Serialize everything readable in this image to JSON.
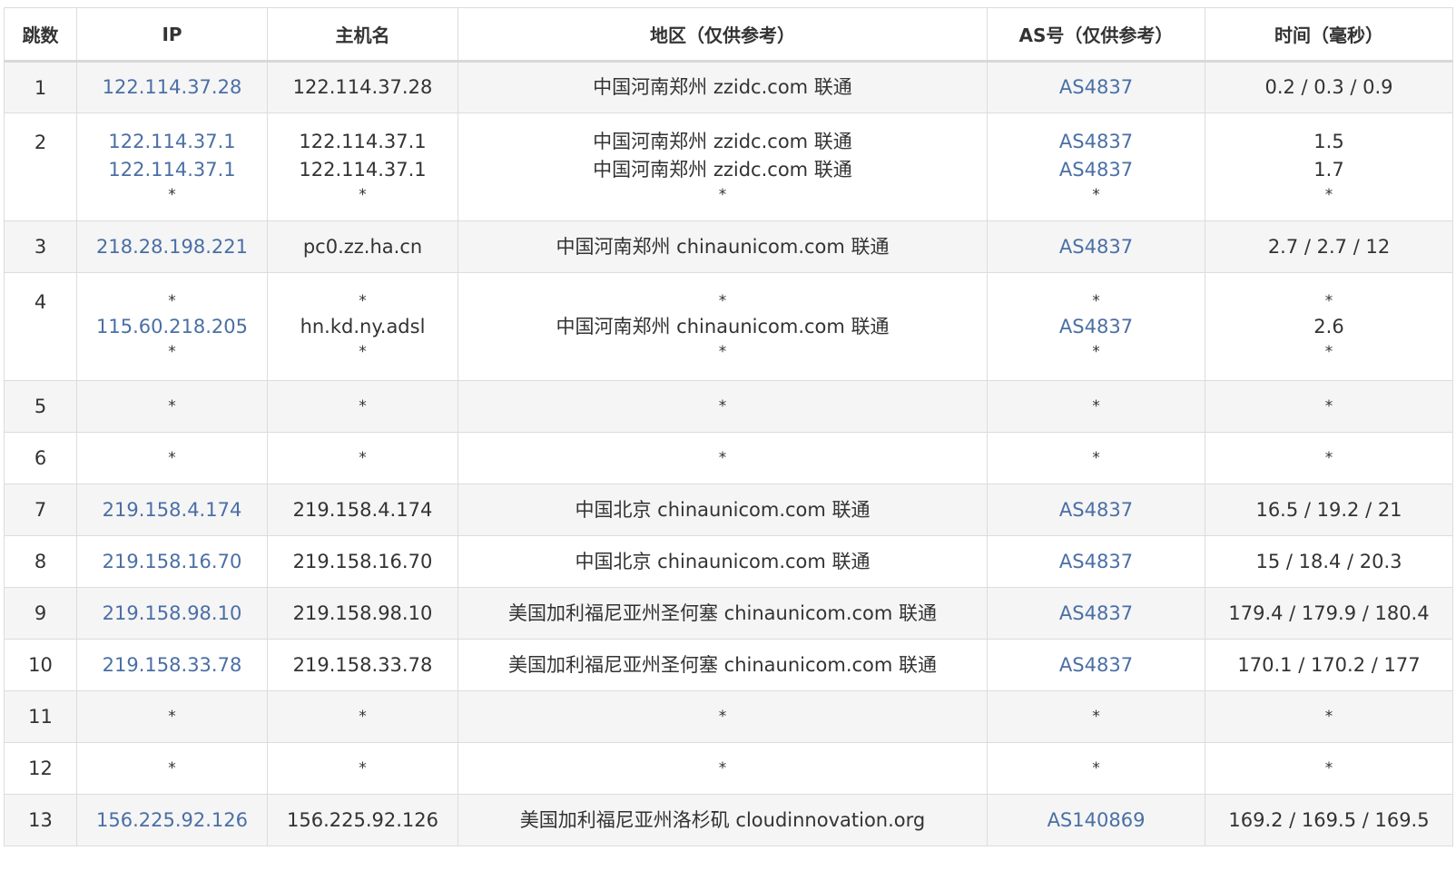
{
  "headers": {
    "hop": "跳数",
    "ip": "IP",
    "host": "主机名",
    "region": "地区（仅供参考）",
    "as": "AS号（仅供参考）",
    "time": "时间（毫秒）"
  },
  "rows": [
    {
      "hop": "1",
      "ip": [
        "122.114.37.28"
      ],
      "host": [
        "122.114.37.28"
      ],
      "region": [
        "中国河南郑州 zzidc.com 联通"
      ],
      "as": [
        "AS4837"
      ],
      "time": [
        "0.2 / 0.3 / 0.9"
      ]
    },
    {
      "hop": "2",
      "ip": [
        "122.114.37.1",
        "122.114.37.1",
        "*"
      ],
      "host": [
        "122.114.37.1",
        "122.114.37.1",
        "*"
      ],
      "region": [
        "中国河南郑州 zzidc.com 联通",
        "中国河南郑州 zzidc.com 联通",
        "*"
      ],
      "as": [
        "AS4837",
        "AS4837",
        "*"
      ],
      "time": [
        "1.5",
        "1.7",
        "*"
      ]
    },
    {
      "hop": "3",
      "ip": [
        "218.28.198.221"
      ],
      "host": [
        "pc0.zz.ha.cn"
      ],
      "region": [
        "中国河南郑州 chinaunicom.com 联通"
      ],
      "as": [
        "AS4837"
      ],
      "time": [
        "2.7 / 2.7 / 12"
      ]
    },
    {
      "hop": "4",
      "ip": [
        "*",
        "115.60.218.205",
        "*"
      ],
      "host": [
        "*",
        "hn.kd.ny.adsl",
        "*"
      ],
      "region": [
        "*",
        "中国河南郑州 chinaunicom.com 联通",
        "*"
      ],
      "as": [
        "*",
        "AS4837",
        "*"
      ],
      "time": [
        "*",
        "2.6",
        "*"
      ]
    },
    {
      "hop": "5",
      "ip": [
        "*"
      ],
      "host": [
        "*"
      ],
      "region": [
        "*"
      ],
      "as": [
        "*"
      ],
      "time": [
        "*"
      ]
    },
    {
      "hop": "6",
      "ip": [
        "*"
      ],
      "host": [
        "*"
      ],
      "region": [
        "*"
      ],
      "as": [
        "*"
      ],
      "time": [
        "*"
      ]
    },
    {
      "hop": "7",
      "ip": [
        "219.158.4.174"
      ],
      "host": [
        "219.158.4.174"
      ],
      "region": [
        "中国北京 chinaunicom.com 联通"
      ],
      "as": [
        "AS4837"
      ],
      "time": [
        "16.5 / 19.2 / 21"
      ]
    },
    {
      "hop": "8",
      "ip": [
        "219.158.16.70"
      ],
      "host": [
        "219.158.16.70"
      ],
      "region": [
        "中国北京 chinaunicom.com 联通"
      ],
      "as": [
        "AS4837"
      ],
      "time": [
        "15 / 18.4 / 20.3"
      ]
    },
    {
      "hop": "9",
      "ip": [
        "219.158.98.10"
      ],
      "host": [
        "219.158.98.10"
      ],
      "region": [
        "美国加利福尼亚州圣何塞 chinaunicom.com 联通"
      ],
      "as": [
        "AS4837"
      ],
      "time": [
        "179.4 / 179.9 / 180.4"
      ]
    },
    {
      "hop": "10",
      "ip": [
        "219.158.33.78"
      ],
      "host": [
        "219.158.33.78"
      ],
      "region": [
        "美国加利福尼亚州圣何塞 chinaunicom.com 联通"
      ],
      "as": [
        "AS4837"
      ],
      "time": [
        "170.1 / 170.2 / 177"
      ]
    },
    {
      "hop": "11",
      "ip": [
        "*"
      ],
      "host": [
        "*"
      ],
      "region": [
        "*"
      ],
      "as": [
        "*"
      ],
      "time": [
        "*"
      ]
    },
    {
      "hop": "12",
      "ip": [
        "*"
      ],
      "host": [
        "*"
      ],
      "region": [
        "*"
      ],
      "as": [
        "*"
      ],
      "time": [
        "*"
      ]
    },
    {
      "hop": "13",
      "ip": [
        "156.225.92.126"
      ],
      "host": [
        "156.225.92.126"
      ],
      "region": [
        "美国加利福尼亚州洛杉矶 cloudinnovation.org"
      ],
      "as": [
        "AS140869"
      ],
      "time": [
        "169.2 / 169.5 / 169.5"
      ]
    }
  ]
}
